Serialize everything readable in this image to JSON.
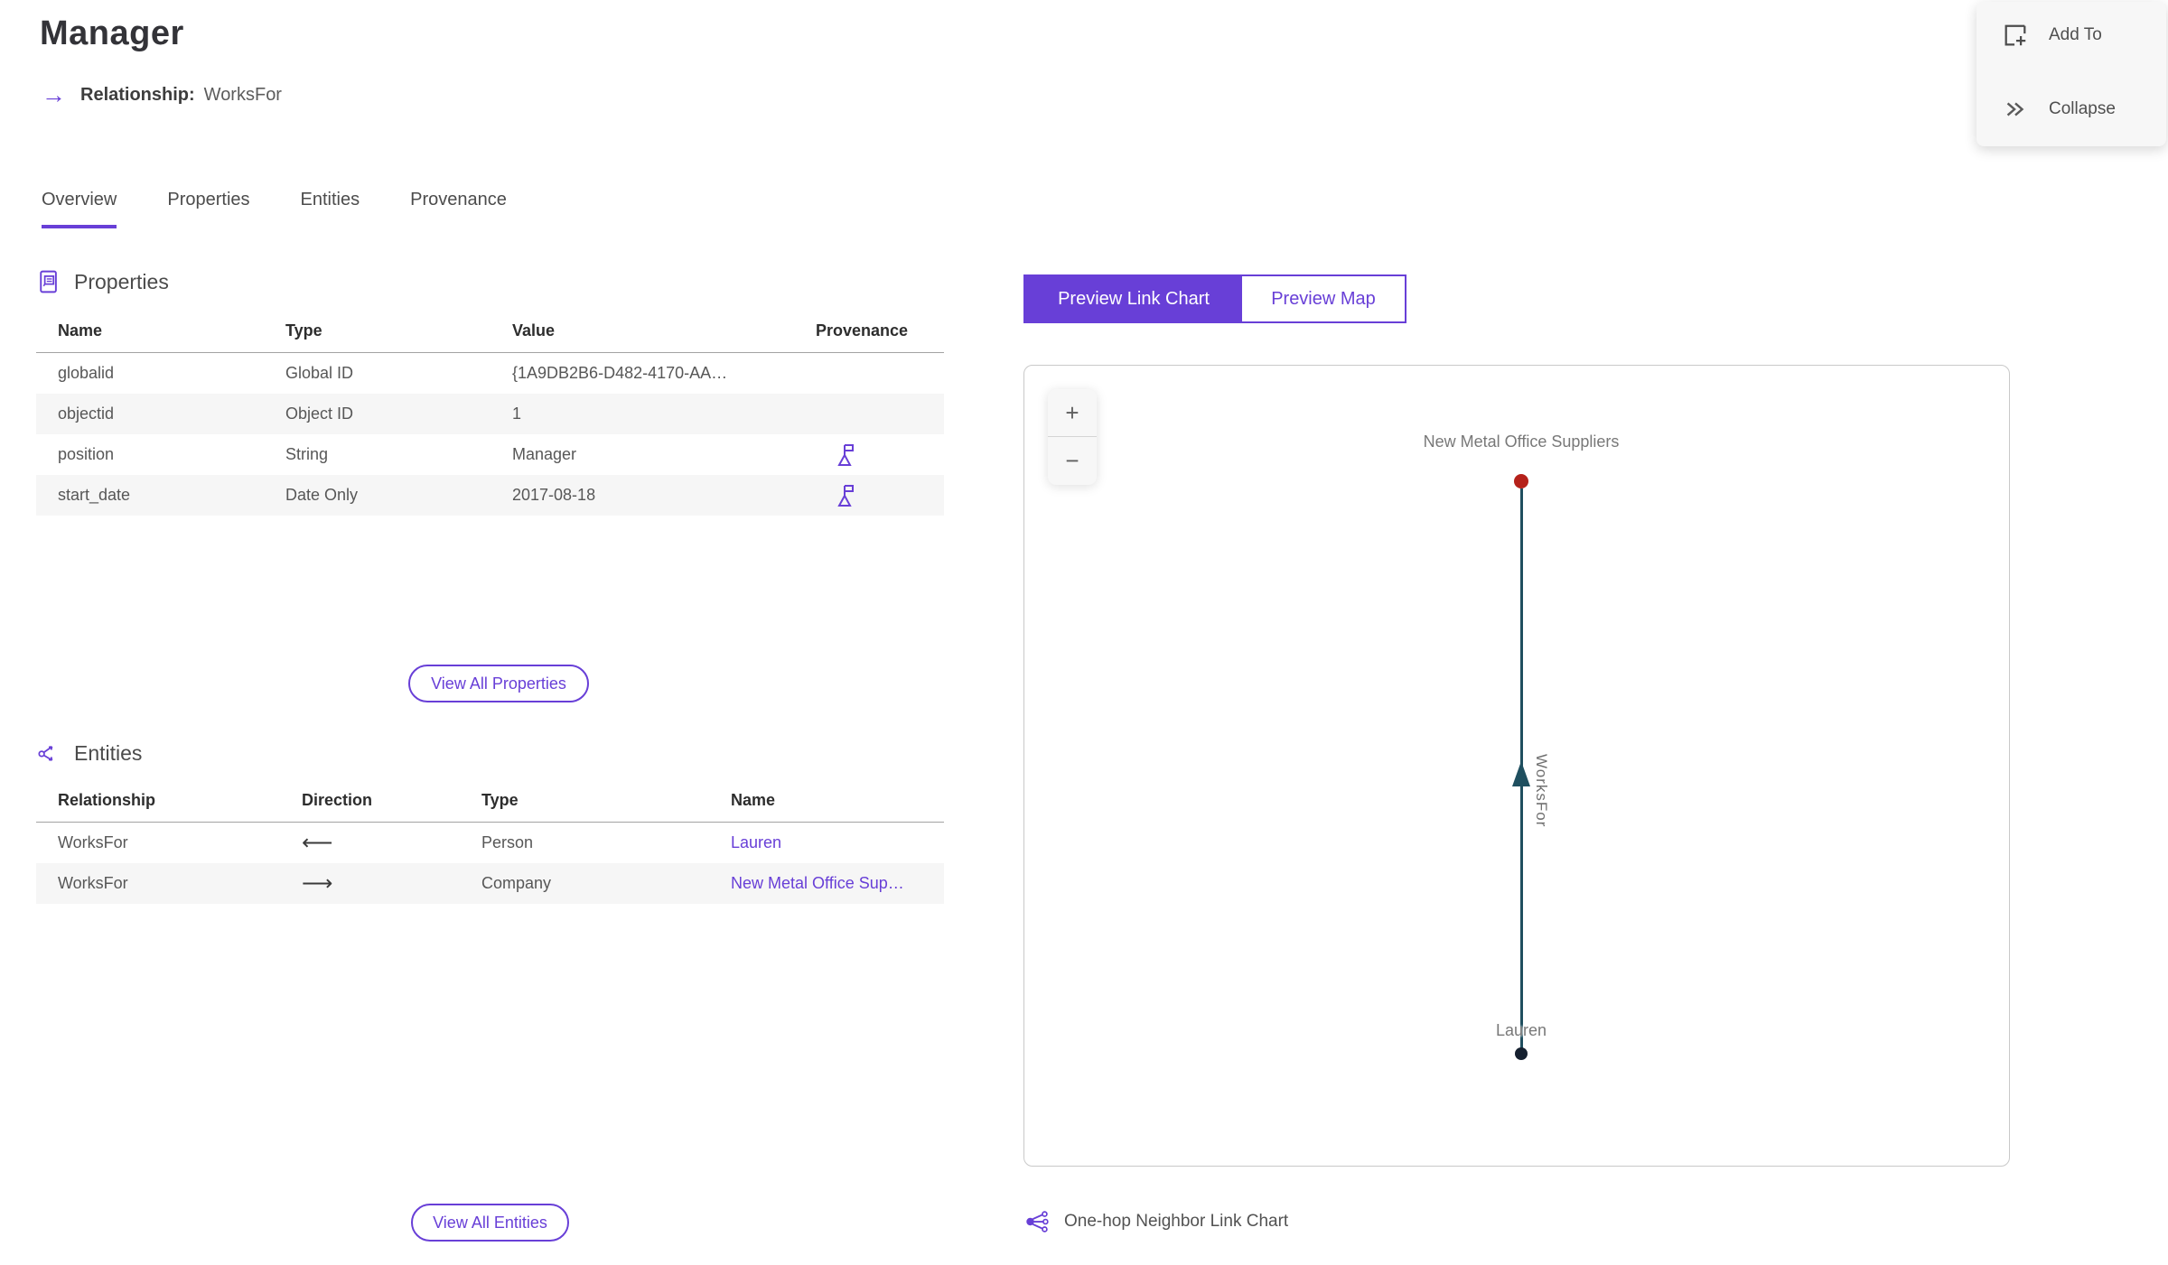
{
  "header": {
    "title": "Manager",
    "relationship_label": "Relationship:",
    "relationship_value": "WorksFor",
    "relationship_arrow": "→"
  },
  "actions": {
    "add_to": "Add To",
    "collapse": "Collapse"
  },
  "tabs": [
    {
      "label": "Overview",
      "active": true
    },
    {
      "label": "Properties",
      "active": false
    },
    {
      "label": "Entities",
      "active": false
    },
    {
      "label": "Provenance",
      "active": false
    }
  ],
  "properties_section": {
    "title": "Properties",
    "columns": {
      "name": "Name",
      "type": "Type",
      "value": "Value",
      "provenance": "Provenance"
    },
    "rows": [
      {
        "name": "globalid",
        "type": "Global ID",
        "value": "{1A9DB2B6-D482-4170-AA…",
        "has_provenance": false
      },
      {
        "name": "objectid",
        "type": "Object ID",
        "value": "1",
        "has_provenance": false
      },
      {
        "name": "position",
        "type": "String",
        "value": "Manager",
        "has_provenance": true
      },
      {
        "name": "start_date",
        "type": "Date Only",
        "value": "2017-08-18",
        "has_provenance": true
      }
    ],
    "view_all_label": "View All Properties"
  },
  "entities_section": {
    "title": "Entities",
    "columns": {
      "relationship": "Relationship",
      "direction": "Direction",
      "type": "Type",
      "name": "Name"
    },
    "rows": [
      {
        "relationship": "WorksFor",
        "direction": "⟵",
        "type": "Person",
        "name": "Lauren"
      },
      {
        "relationship": "WorksFor",
        "direction": "⟶",
        "type": "Company",
        "name": "New Metal Office Sup…"
      }
    ],
    "view_all_label": "View All Entities"
  },
  "preview": {
    "toggle": {
      "link_chart": "Preview Link Chart",
      "map": "Preview Map"
    },
    "zoom_in": "+",
    "zoom_out": "−",
    "footer": "One-hop Neighbor Link Chart"
  },
  "link_chart": {
    "top_node": {
      "label": "New Metal Office Suppliers",
      "color": "#B5211A",
      "type": "Company"
    },
    "bottom_node": {
      "label": "Lauren",
      "color": "#15202F",
      "type": "Person"
    },
    "edge": {
      "label": "WorksFor",
      "color": "#1F4F5F",
      "direction": "bottom-to-top"
    }
  },
  "colors": {
    "accent": "#683FD7",
    "edge_teal": "#1F4F5F",
    "node_red": "#B5211A",
    "node_dark": "#15202F",
    "row_alt": "#F6F6F6"
  }
}
